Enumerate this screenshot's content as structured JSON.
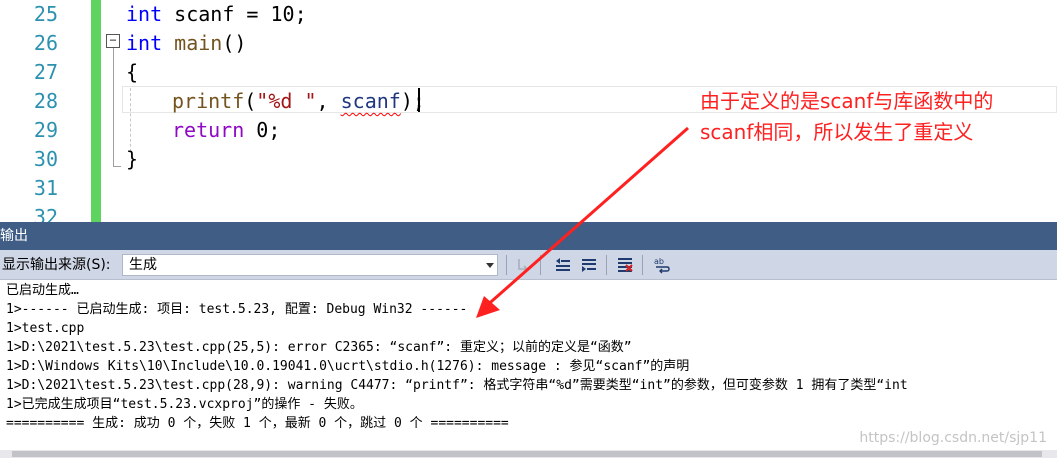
{
  "editor": {
    "line_numbers": [
      "25",
      "26",
      "27",
      "28",
      "29",
      "30",
      "31",
      "32"
    ],
    "code": {
      "l25": {
        "kw": "int",
        "rest": " scanf = 10;"
      },
      "l26": {
        "kw": "int",
        "fn": " main",
        "rest": "()"
      },
      "l27": "{",
      "l28": {
        "fn": "printf",
        "p1": "(",
        "str": "\"%d \"",
        "p2": ", ",
        "var": "scanf",
        "p3": ");"
      },
      "l29": {
        "kw": "return",
        "rest": " 0;"
      },
      "l30": "}"
    },
    "collapse_glyph": "−"
  },
  "annotation": {
    "line1": "由于定义的是scanf与库函数中的",
    "line2": "scanf相同，所以发生了重定义",
    "color": "#ff2020"
  },
  "output_panel": {
    "title": "输出",
    "source_label": "显示输出来源(S):",
    "source_value": "生成",
    "toolbar_icons": [
      "find-message-icon",
      "prev-message-icon",
      "next-message-icon",
      "clear-all-icon",
      "word-wrap-icon"
    ],
    "lines": [
      "已启动生成…",
      "1>------ 已启动生成: 项目: test.5.23, 配置: Debug Win32 ------",
      "1>test.cpp",
      "1>D:\\2021\\test.5.23\\test.cpp(25,5): error C2365: “scanf”: 重定义；以前的定义是“函数”",
      "1>D:\\Windows Kits\\10\\Include\\10.0.19041.0\\ucrt\\stdio.h(1276): message : 参见“scanf”的声明",
      "1>D:\\2021\\test.5.23\\test.cpp(28,9): warning C4477: “printf”: 格式字符串“%d”需要类型“int”的参数，但可变参数 1 拥有了类型“int",
      "1>已完成生成项目“test.5.23.vcxproj”的操作 - 失败。",
      "========== 生成: 成功 0 个，失败 1 个，最新 0 个，跳过 0 个 =========="
    ]
  },
  "watermark": "https://blog.csdn.net/sjp11",
  "colors": {
    "title_bar": "#3f5d85",
    "toolbar": "#cfd6e5",
    "change_bar": "#5fd35f",
    "arrow": "#ff2020"
  }
}
